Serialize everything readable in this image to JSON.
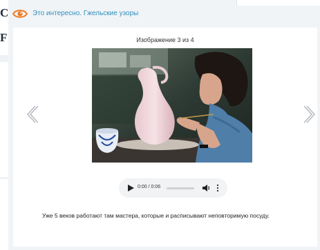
{
  "background_page": {
    "glyph_top": "C]",
    "glyph_second": "F"
  },
  "popup": {
    "title": "Это интересно. Гжельские узоры",
    "counter": "Изображение 3 из 4",
    "caption": "Уже 5 веков работают там мастера, которые и расписывают неповторимую посуду."
  },
  "audio": {
    "time": "0:00 / 0:06",
    "progress": 0
  },
  "icons": {
    "title_icon": "eye-icon",
    "prev": "chevron-left-icon",
    "next": "chevron-right-icon",
    "play": "play-icon",
    "volume": "volume-icon",
    "more": "more-vertical-icon"
  },
  "colors": {
    "accent_orange": "#f07a1f",
    "title_blue": "#2f8fbf",
    "chevron_gray": "#b7bcc2"
  }
}
